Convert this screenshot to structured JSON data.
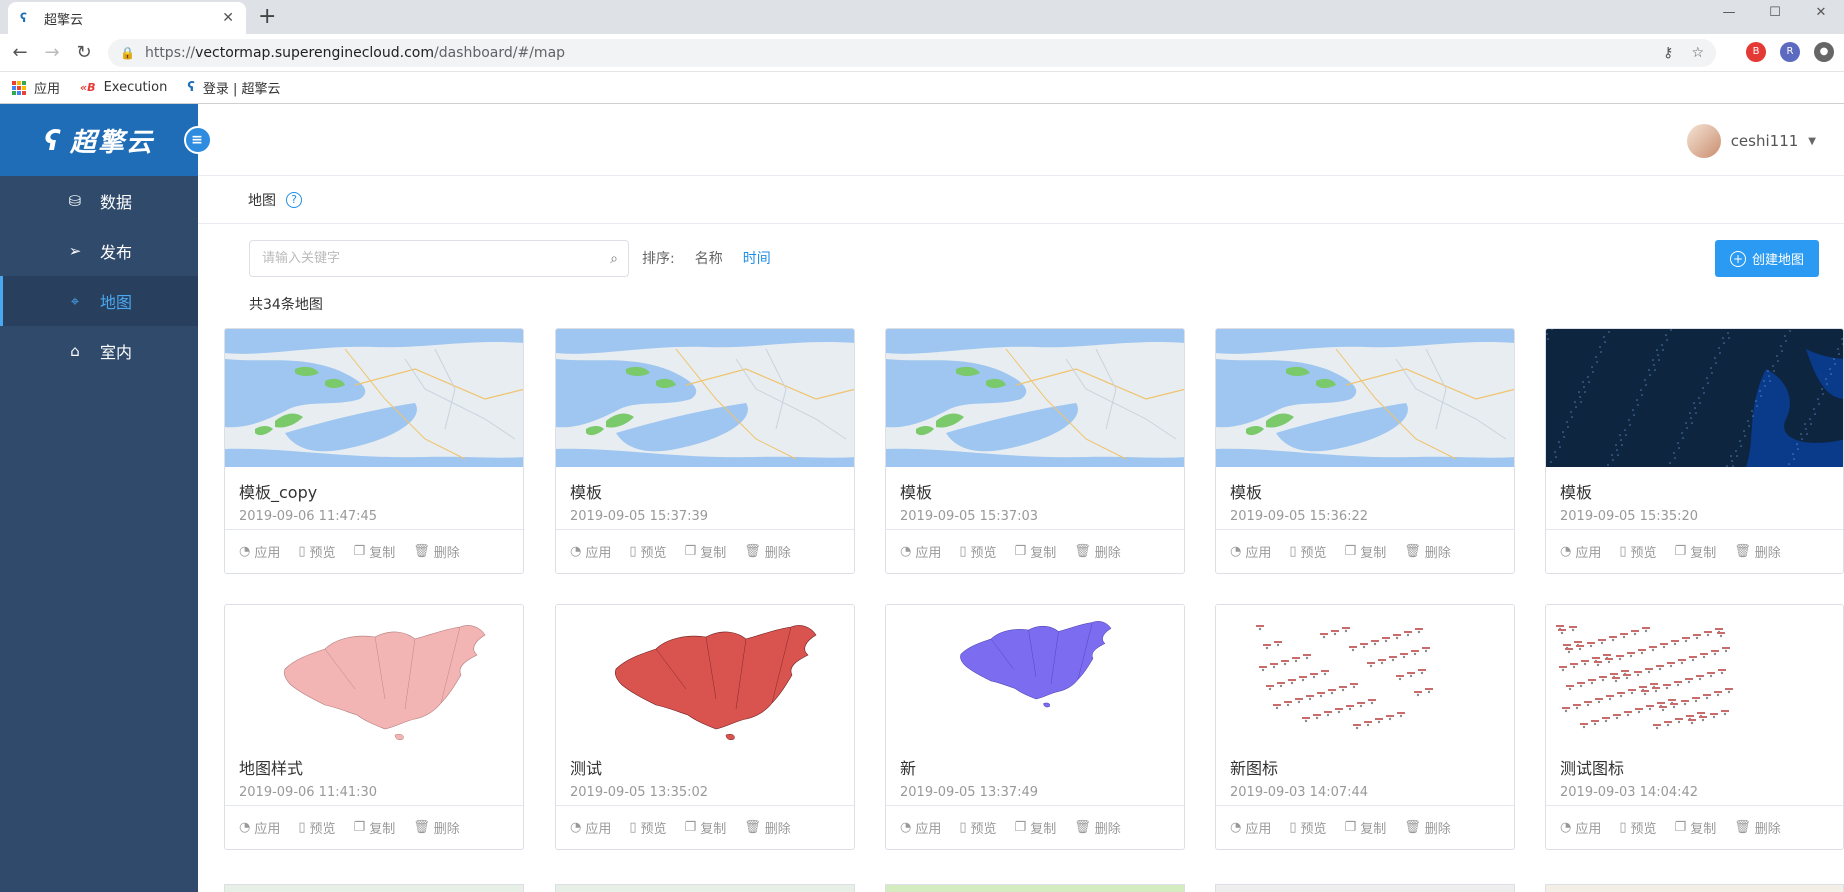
{
  "browser": {
    "tab_title": "超擎云",
    "new_tab": "+",
    "url_proto": "https://",
    "url_host": "vectormap.superenginecloud.com",
    "url_path": "/dashboard/#/map",
    "bookmarks": [
      {
        "label": "应用"
      },
      {
        "label": "Execution"
      },
      {
        "label": "登录 | 超擎云"
      }
    ]
  },
  "app": {
    "logo_text": "超擎云",
    "menu": [
      {
        "label": "数据",
        "icon": "database-icon",
        "active": false
      },
      {
        "label": "发布",
        "icon": "send-icon",
        "active": false
      },
      {
        "label": "地图",
        "icon": "map-pin-icon",
        "active": true
      },
      {
        "label": "室内",
        "icon": "indoor-icon",
        "active": false
      }
    ],
    "username": "ceshi111",
    "breadcrumb": "地图",
    "search_placeholder": "请输入关键字",
    "sort_label": "排序:",
    "sort_options": [
      "名称",
      "时间"
    ],
    "create_label": "创建地图",
    "count_text": "共34条地图",
    "action_labels": [
      "应用",
      "预览",
      "复制",
      "删除"
    ],
    "cards": [
      {
        "name": "模板_copy",
        "date": "2019-09-06 11:47:45",
        "thumb": "light-map"
      },
      {
        "name": "模板",
        "date": "2019-09-05 15:37:39",
        "thumb": "light-map"
      },
      {
        "name": "模板",
        "date": "2019-09-05 15:37:03",
        "thumb": "light-map"
      },
      {
        "name": "模板",
        "date": "2019-09-05 15:36:22",
        "thumb": "light-map"
      },
      {
        "name": "模板",
        "date": "2019-09-05 15:35:20",
        "thumb": "dark-map"
      },
      {
        "name": "地图样式",
        "date": "2019-09-06 11:41:30",
        "thumb": "china-pink"
      },
      {
        "name": "测试",
        "date": "2019-09-05 13:35:02",
        "thumb": "china-red"
      },
      {
        "name": "新",
        "date": "2019-09-05 13:37:49",
        "thumb": "china-purple"
      },
      {
        "name": "新图标",
        "date": "2019-09-03 14:07:44",
        "thumb": "china-markers"
      },
      {
        "name": "测试图标",
        "date": "2019-09-03 14:04:42",
        "thumb": "china-markers-dense"
      }
    ],
    "colors": {
      "accent": "#2b9af3",
      "sidebar": "#2f4a6b",
      "logo_bg": "#1f6db6"
    }
  }
}
